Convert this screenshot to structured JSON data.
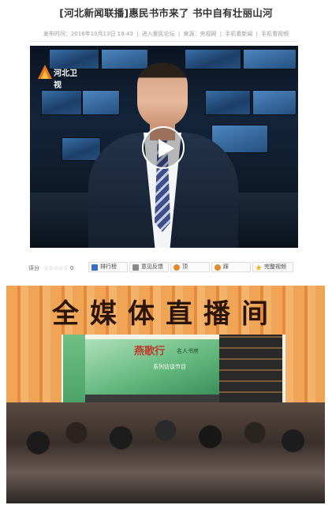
{
  "article": {
    "title": "[河北新闻联播]惠民书市来了 书中自有壮丽山河",
    "meta": {
      "published": "发布时间：2016年10月13日 19:43",
      "forum": "进入爱民论坛",
      "source": "来源：央视网",
      "news": "手机看新闻",
      "video": "手机看视频"
    }
  },
  "video": {
    "channel_logo": "河北卫视",
    "play_icon": "play-icon"
  },
  "toolbar": {
    "rating_label": "评分",
    "stars": "☆☆☆☆☆",
    "score": "0",
    "buttons": [
      {
        "label": "排行榜",
        "icon": "chart-icon",
        "color": "#3b6fc4"
      },
      {
        "label": "意见反馈",
        "icon": "feedback-icon",
        "color": "#8a8a8a"
      },
      {
        "label": "顶",
        "icon": "thumb-up-icon",
        "color": "#e58a2b"
      },
      {
        "label": "踩",
        "icon": "thumb-down-icon",
        "color": "#e58a2b"
      },
      {
        "label": "完整视频",
        "icon": "star-icon",
        "color": "#e8b420"
      }
    ]
  },
  "photo": {
    "banner": "全媒体直播间",
    "screen_title": "燕歌行",
    "screen_subtitle": "名人书房",
    "screen_caption": "系列访谈节目"
  }
}
